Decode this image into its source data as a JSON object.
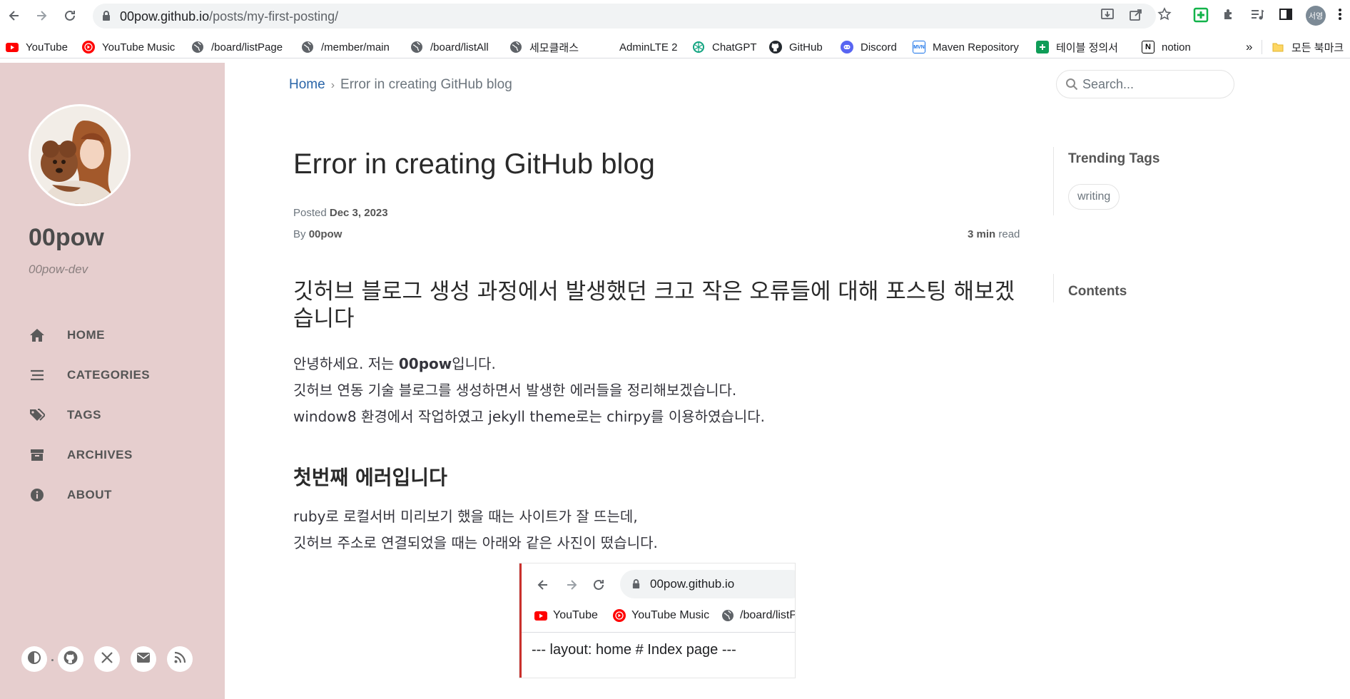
{
  "browser": {
    "url_host": "00pow.github.io",
    "url_path": "/posts/my-first-posting/",
    "profile_initials": "서영",
    "bookmarks": [
      {
        "label": "YouTube",
        "icon": "youtube-icon",
        "color": "#ff0000"
      },
      {
        "label": "YouTube Music",
        "icon": "youtube-music-icon",
        "color": "#ff0000"
      },
      {
        "label": "/board/listPage",
        "icon": "globe-icon",
        "color": "#5f6368"
      },
      {
        "label": "/member/main",
        "icon": "globe-icon",
        "color": "#5f6368"
      },
      {
        "label": "/board/listAll",
        "icon": "globe-icon",
        "color": "#5f6368"
      },
      {
        "label": "세모클래스",
        "icon": "globe-icon",
        "color": "#5f6368"
      },
      {
        "label": "AdminLTE 2",
        "icon": "adminlte-icon",
        "color": "#ffffff"
      },
      {
        "label": "ChatGPT",
        "icon": "chatgpt-icon",
        "color": "#10a37f"
      },
      {
        "label": "GitHub",
        "icon": "github-icon",
        "color": "#24292f"
      },
      {
        "label": "Discord",
        "icon": "discord-icon",
        "color": "#5865f2"
      },
      {
        "label": "Maven Repository",
        "icon": "maven-icon",
        "color": "#1a73e8"
      },
      {
        "label": "테이블 정의서",
        "icon": "sheets-icon",
        "color": "#0f9d58"
      },
      {
        "label": "notion",
        "icon": "notion-icon",
        "color": "#000000"
      }
    ],
    "overflow_label": "»",
    "all_bookmarks_label": "모든 북마크"
  },
  "sidebar": {
    "site_title": "00pow",
    "site_subtitle": "00pow-dev",
    "nav": [
      {
        "label": "HOME",
        "icon": "home-icon"
      },
      {
        "label": "CATEGORIES",
        "icon": "stream-icon"
      },
      {
        "label": "TAGS",
        "icon": "tags-icon"
      },
      {
        "label": "ARCHIVES",
        "icon": "archive-icon"
      },
      {
        "label": "ABOUT",
        "icon": "info-icon"
      }
    ],
    "bottom_icons": [
      "theme-toggle-icon",
      "github-icon",
      "x-twitter-icon",
      "email-icon",
      "rss-icon"
    ],
    "bg_color": "#e6cece"
  },
  "main": {
    "breadcrumb": {
      "home": "Home",
      "sep": "›",
      "current": "Error in creating GitHub blog"
    },
    "search_placeholder": "Search...",
    "post": {
      "title": "Error in creating GitHub blog",
      "posted_label": "Posted",
      "posted_date": "Dec 3, 2023",
      "by_label": "By",
      "author": "00pow",
      "read_time_value": "3 min",
      "read_time_suffix": "read",
      "heading": "깃허브 블로그 생성 과정에서 발생했던 크고 작은 오류들에 대해 포스팅 해보겠습니다",
      "intro_prefix": "안녕하세요. 저는 ",
      "intro_bold": "00pow",
      "intro_suffix": "입니다.",
      "intro_line2": "깃허브 연동 기술 블로그를 생성하면서 발생한 에러들을 정리해보겠습니다.",
      "intro_line3": "window8 환경에서 작업하였고 jekyll theme로는 chirpy를 이용하였습니다.",
      "section_heading": "첫번째 에러입니다",
      "section_line1": "ruby로 로컬서버 미리보기 했을 때는 사이트가 잘 뜨는데,",
      "section_line2": "깃허브 주소로 연결되었을 때는 아래와 같은 사진이 떴습니다.",
      "embed": {
        "url": "00pow.github.io",
        "bm1": "YouTube",
        "bm2": "YouTube Music",
        "bm3": "/board/listP",
        "code": "--- layout: home # Index page ---"
      }
    }
  },
  "panel": {
    "trending_heading": "Trending Tags",
    "tags": [
      "writing"
    ],
    "contents_heading": "Contents"
  },
  "colors": {
    "link": "#2a65a8",
    "accent_red": "#c9302c"
  }
}
